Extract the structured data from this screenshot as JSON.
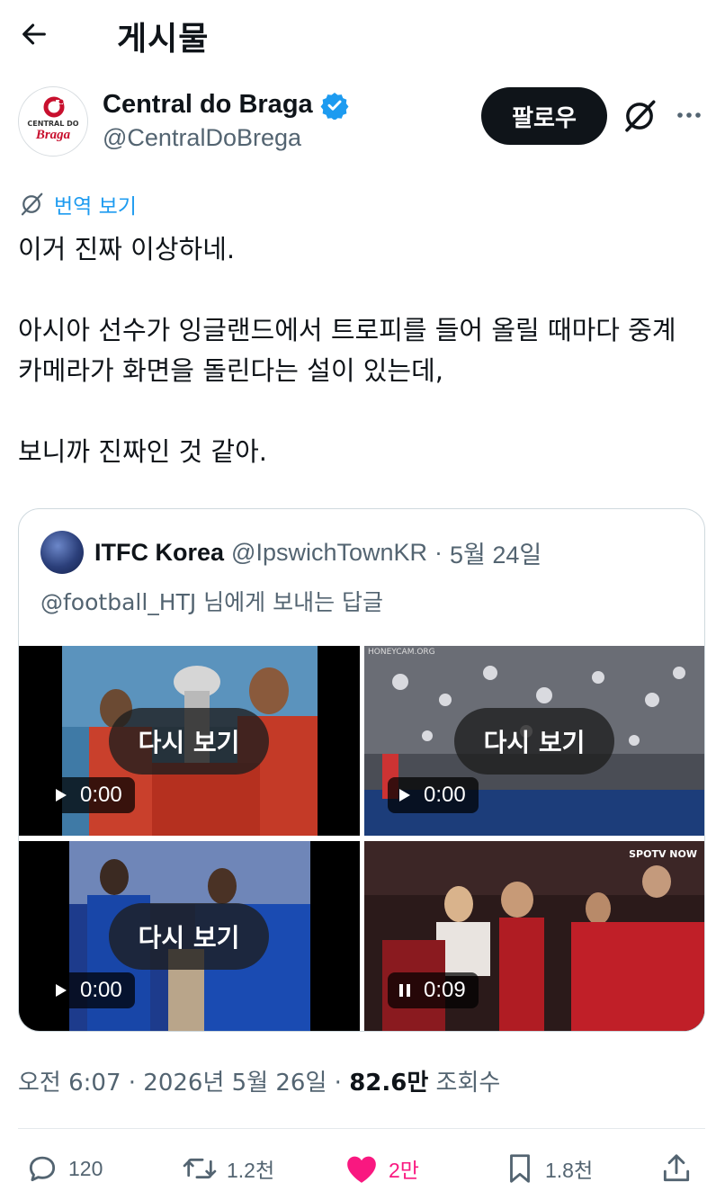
{
  "header": {
    "title": "게시물"
  },
  "author": {
    "name": "Central do Braga",
    "handle": "@CentralDoBrega",
    "avatar_text_top": "CENTRAL DO",
    "avatar_text_bottom": "Braga",
    "follow_label": "팔로우"
  },
  "translate_label": "번역 보기",
  "tweet": {
    "text": "이거 진짜 이상하네.\n\n아시아 선수가 잉글랜드에서 트로피를 들어 올릴 때마다 중계 카메라가 화면을 돌린다는 설이 있는데,\n\n보니까 진짜인 것 같아."
  },
  "quote": {
    "name": "ITFC Korea",
    "handle": "@IpswichTownKR",
    "date": "5월 24일",
    "separator": "·",
    "reply_to": "@football_HTJ 님에게 보내는 답글",
    "media": [
      {
        "replay_label": "다시 보기",
        "time": "0:00",
        "state": "play"
      },
      {
        "replay_label": "다시 보기",
        "time": "0:00",
        "state": "play"
      },
      {
        "replay_label": "다시 보기",
        "time": "0:00",
        "state": "play"
      },
      {
        "replay_label": "",
        "time": "0:09",
        "state": "pause"
      }
    ],
    "overlay_texts": {
      "honeycam": "HONEYCAM.ORG",
      "spotv": "SPOTV NOW"
    }
  },
  "meta": {
    "time": "오전 6:07",
    "date": "2026년 5월 26일",
    "views": "82.6만",
    "views_label": "조회수",
    "sep": "·"
  },
  "actions": {
    "replies": "120",
    "reposts": "1.2천",
    "likes": "2만",
    "bookmarks": "1.8천"
  },
  "colors": {
    "accent": "#1d9bf0",
    "like": "#f91880",
    "text": "#0f1419",
    "muted": "#536471"
  }
}
